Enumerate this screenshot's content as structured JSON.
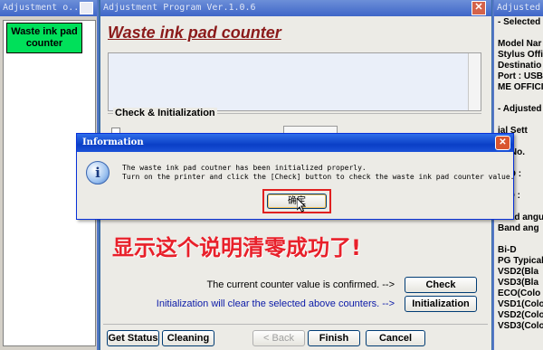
{
  "left_window": {
    "title": "Adjustment o...",
    "waste_button_label": "Waste ink pad counter"
  },
  "main_window": {
    "title": "Adjustment Program Ver.1.0.6",
    "close_glyph": "✕",
    "heading": "Waste ink pad counter",
    "group_label": "Check & Initialization",
    "chinese_note": "显示这个说明清零成功了!",
    "confirmed_text": "The current counter value is confirmed. -->",
    "check_button": "Check",
    "init_text": "Initialization will clear the selected above counters. -->",
    "init_button": "Initialization",
    "get_status_button": "Get Status",
    "cleaning_button": "Cleaning",
    "back_button": "< Back",
    "finish_button": "Finish",
    "cancel_button": "Cancel"
  },
  "right_window": {
    "title": "Adjusted",
    "lines": [
      "- Selected",
      "",
      "Model Nar",
      "Stylus Offi",
      "Destinatio",
      "Port : USB",
      "ME OFFICI",
      "",
      "- Adjusted",
      "",
      "ial Sett",
      "",
      "ial No.",
      "",
      "B ID :",
      "",
      "d ID :",
      "",
      "Head angu",
      "Band ang",
      "",
      "Bi-D",
      "PG Typical",
      "VSD2(Bla",
      "VSD3(Bla",
      "ECO(Colo",
      "VSD1(Colo",
      "VSD2(Colo",
      "VSD3(Colo"
    ]
  },
  "dialog": {
    "title": "Information",
    "close_glyph": "✕",
    "icon_glyph": "i",
    "message_line1": "The waste ink pad coutner has been initialized properly.",
    "message_line2": "Turn on the printer and click the [Check] button to check the waste ink pad counter value.",
    "ok_button": "确定"
  },
  "colors": {
    "accent_red": "#e8202a",
    "waste_button_green": "#00e05a",
    "title_bar_blue": "#0a3fc6"
  },
  "icons": [
    "information-icon",
    "close-icon",
    "mouse-cursor-icon"
  ]
}
